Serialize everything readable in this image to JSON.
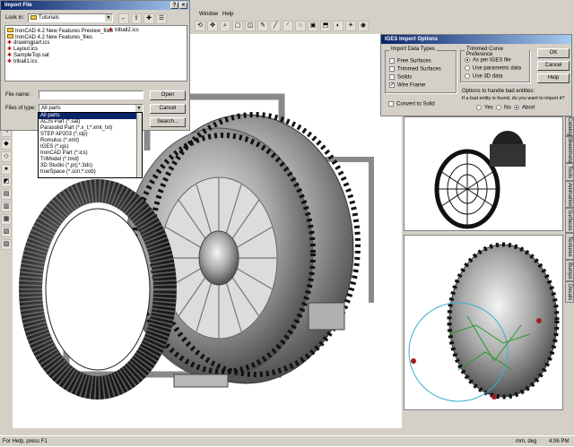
{
  "main_window": {
    "menu": [
      "Window",
      "Help"
    ],
    "status": {
      "left": "For Help, press F1",
      "units": "mm, deg",
      "time": "4:06 PM"
    },
    "side_tabs": [
      "Catalogs",
      "Sheetmetal",
      "Tools",
      "Animation",
      "Surfaces",
      "Textures",
      "Bumps",
      "Decals"
    ]
  },
  "import_file": {
    "title": "Import File",
    "look_in_label": "Look in:",
    "look_in_value": "Tutorials",
    "files_col1": [
      "IronCAD 4.2 New Features Preview_files",
      "IronCAD 4.2 New Features_files",
      "drawingpart.ics",
      "Layout.ics",
      "SampleTop.sat",
      "triball1.ics"
    ],
    "files_col2": [
      "triball2.ics"
    ],
    "file_name_label": "File name:",
    "file_name_value": "",
    "files_of_type_label": "Files of type:",
    "files_of_type_value": "All parts",
    "type_options": [
      "All parts",
      "ACIS Part (*.sat)",
      "Parasolid Part (*.x_t;*.xmt_txt)",
      "STEP AP203 (*.stp)",
      "Romulus (*.xmt)",
      "IGES (*.igs)",
      "IronCAD Part (*.ics)",
      "TriModel (*.tmd)",
      "3D Studio (*.prj;*.3ds)",
      "trueSpace (*.scn;*.cob)"
    ],
    "open_label": "Open",
    "cancel_label": "Cancel",
    "search_label": "Search..."
  },
  "iges_options": {
    "title": "IGES Import Options",
    "import_types_title": "Import Data Types",
    "import_types": [
      {
        "label": "Free Surfaces",
        "checked": false
      },
      {
        "label": "Trimmed Surfaces",
        "checked": false
      },
      {
        "label": "Solids",
        "checked": false
      },
      {
        "label": "Wire Frame",
        "checked": true
      }
    ],
    "convert_label": "Convert to Solid",
    "curve_pref_title": "Trimmed Curve Preference",
    "curve_prefs": [
      {
        "label": "As per IGES file",
        "selected": true
      },
      {
        "label": "Use parametric data",
        "selected": false
      },
      {
        "label": "Use 3D data",
        "selected": false
      }
    ],
    "bad_entity_text1": "Options to handle bad entities:",
    "bad_entity_text2": "If a bad entity is found, do you want to import it?",
    "bad_entity_opts": [
      {
        "label": "Yes",
        "selected": false
      },
      {
        "label": "No",
        "selected": false
      },
      {
        "label": "Abort",
        "selected": true
      }
    ],
    "ok_label": "OK",
    "cancel_label": "Cancel",
    "help_label": "Help"
  },
  "colors": {
    "titlebar_dark": "#0a246a",
    "dialog_gray": "#d4d0c8",
    "selection": "#0a246a"
  }
}
